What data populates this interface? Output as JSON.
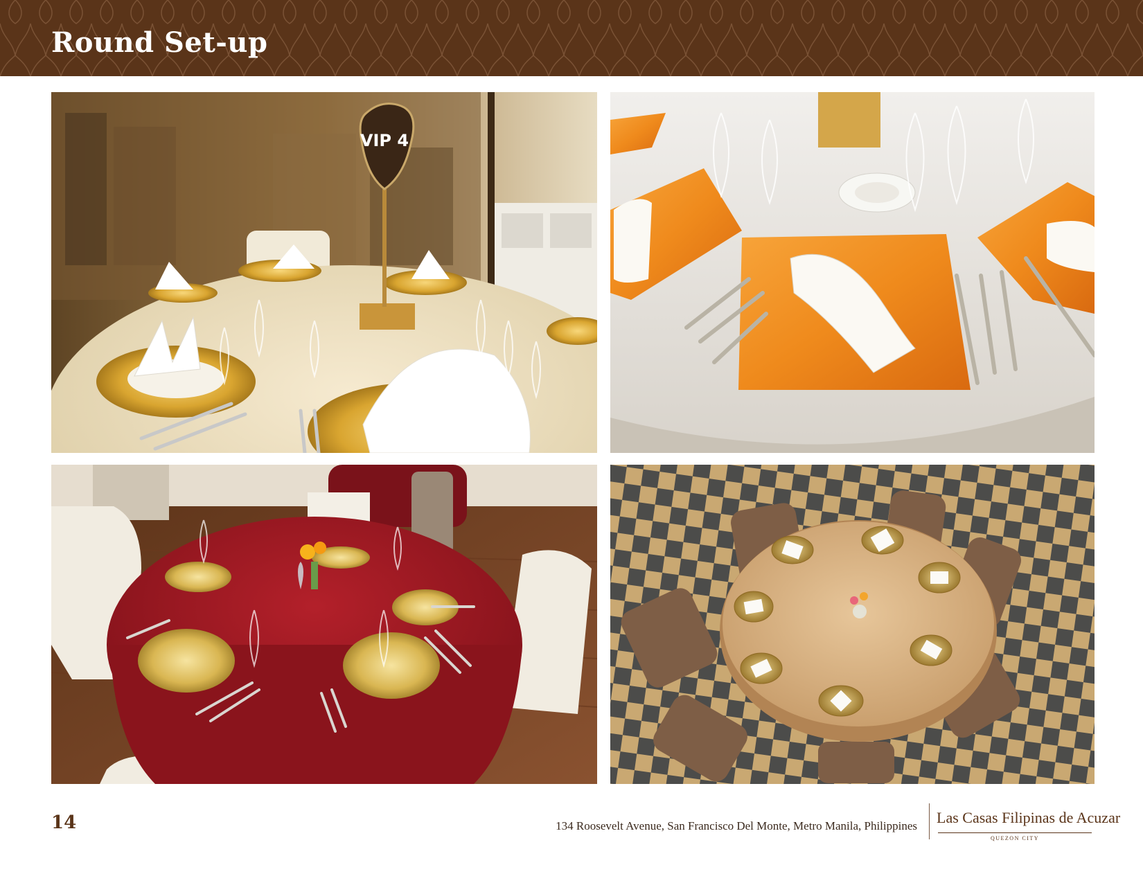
{
  "header": {
    "title": "Round Set-up",
    "band_color": "#5a3419"
  },
  "photos": [
    {
      "subject": "round table with gold chargers, white napkins and VIP 4 table marker",
      "marker_text": "VIP 4"
    },
    {
      "subject": "white tablecloth with orange square chargers and folded napkins"
    },
    {
      "subject": "red damask round table with gold chargers and white chair covers"
    },
    {
      "subject": "top view of gold damask round table on checkered tile floor"
    }
  ],
  "footer": {
    "page_number": "14",
    "address": "134 Roosevelt Avenue, San Francisco Del Monte, Metro Manila, Philippines",
    "logo_name": "Las Casas Filipinas de Acuzar",
    "logo_city": "QUEZON CITY"
  }
}
